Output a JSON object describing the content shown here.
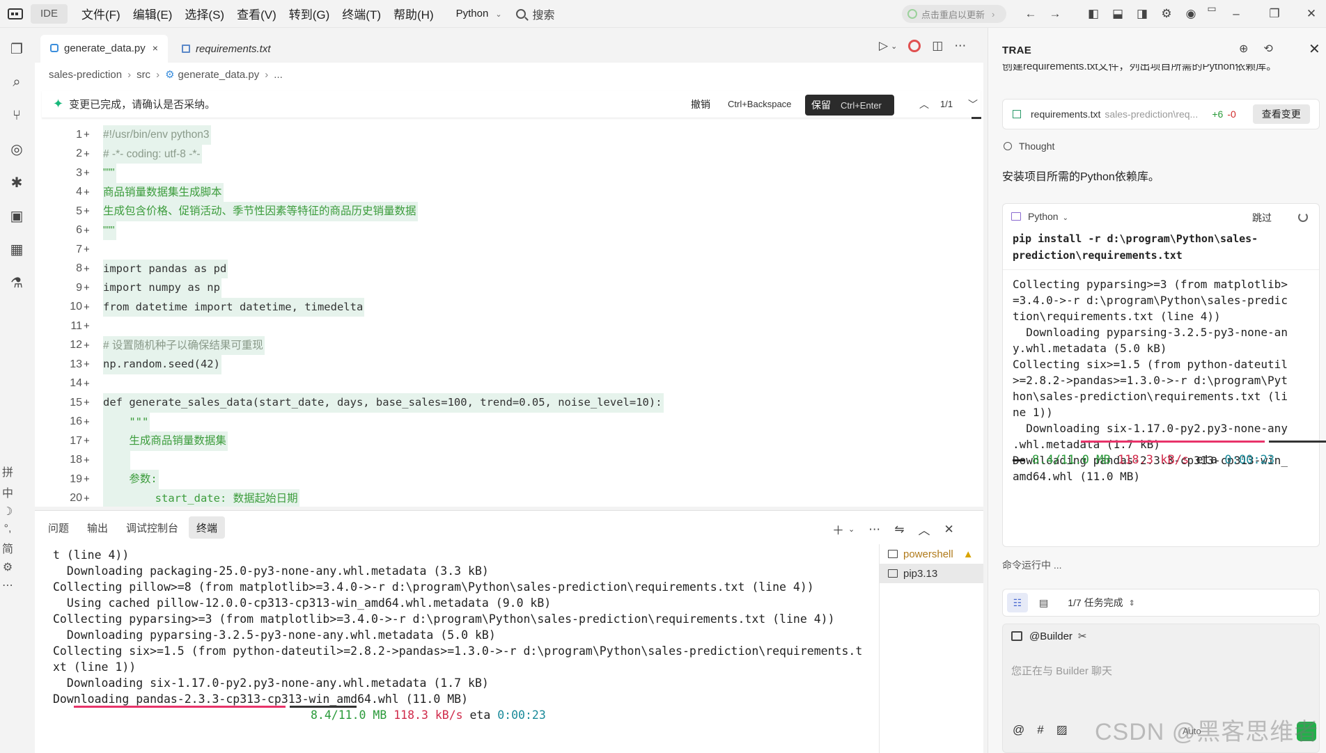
{
  "titlebar": {
    "ide_label": "IDE",
    "menu": [
      "文件(F)",
      "编辑(E)",
      "选择(S)",
      "查看(V)",
      "转到(G)",
      "终端(T)",
      "帮助(H)"
    ],
    "language": "Python",
    "search_label": "搜索",
    "update_label": "点击重启以更新"
  },
  "editor": {
    "tabs": [
      {
        "label": "generate_data.py",
        "close": "×"
      },
      {
        "label": "requirements.txt"
      }
    ],
    "breadcrumb": [
      "sales-prediction",
      "src",
      "generate_data.py",
      "..."
    ],
    "confirm": {
      "message": "变更已完成，请确认是否采纳。",
      "undo_label": "撤销",
      "undo_shortcut": "Ctrl+Backspace",
      "keep_label": "保留",
      "keep_shortcut": "Ctrl+Enter",
      "counter": "1/1"
    },
    "lines": [
      {
        "n": "1",
        "text": "#!/usr/bin/env python3"
      },
      {
        "n": "2",
        "text": "# -*- coding: utf-8 -*-"
      },
      {
        "n": "3",
        "text": "\"\"\""
      },
      {
        "n": "4",
        "text": "商品销量数据集生成脚本"
      },
      {
        "n": "5",
        "text": "生成包含价格、促销活动、季节性因素等特征的商品历史销量数据"
      },
      {
        "n": "6",
        "text": "\"\"\""
      },
      {
        "n": "7",
        "text": ""
      },
      {
        "n": "8",
        "text": "import pandas as pd"
      },
      {
        "n": "9",
        "text": "import numpy as np"
      },
      {
        "n": "10",
        "text": "from datetime import datetime, timedelta"
      },
      {
        "n": "11",
        "text": ""
      },
      {
        "n": "12",
        "text": "# 设置随机种子以确保结果可重现"
      },
      {
        "n": "13",
        "text": "np.random.seed(42)"
      },
      {
        "n": "14",
        "text": ""
      },
      {
        "n": "15",
        "text": "def generate_sales_data(start_date, days, base_sales=100, trend=0.05, noise_level=10):"
      },
      {
        "n": "16",
        "text": "    \"\"\""
      },
      {
        "n": "17",
        "text": "    生成商品销量数据集"
      },
      {
        "n": "18",
        "text": "    "
      },
      {
        "n": "19",
        "text": "    参数:"
      },
      {
        "n": "20",
        "text": "        start_date: 数据起始日期"
      }
    ]
  },
  "terminal": {
    "tabs": [
      "问题",
      "输出",
      "调试控制台",
      "终端"
    ],
    "active_tab": "终端",
    "sessions": [
      "powershell",
      "pip3.13"
    ],
    "lines": [
      "t (line 4))",
      "  Downloading packaging-25.0-py3-none-any.whl.metadata (3.3 kB)",
      "Collecting pillow>=8 (from matplotlib>=3.4.0->-r d:\\program\\Python\\sales-prediction\\requirements.txt (line 4))",
      "  Using cached pillow-12.0.0-cp313-cp313-win_amd64.whl.metadata (9.0 kB)",
      "Collecting pyparsing>=3 (from matplotlib>=3.4.0->-r d:\\program\\Python\\sales-prediction\\requirements.txt (line 4))",
      "  Downloading pyparsing-3.2.5-py3-none-any.whl.metadata (5.0 kB)",
      "Collecting six>=1.5 (from python-dateutil>=2.8.2->pandas>=1.3.0->-r d:\\program\\Python\\sales-prediction\\requirements.t",
      "xt (line 1))",
      "  Downloading six-1.17.0-py2.py3-none-any.whl.metadata (1.7 kB)",
      "Downloading pandas-2.3.3-cp313-cp313-win_amd64.whl (11.0 MB)"
    ],
    "progress": {
      "size": "8.4/11.0 MB",
      "speed": "118.3 kB/s",
      "eta_label": "eta",
      "eta": "0:00:23",
      "fraction": 0.76
    }
  },
  "chat": {
    "title": "TRAE",
    "cut_text": "创建requirements.txt文件，列出项目所需的Python依赖库。",
    "file_card": {
      "name": "requirements.txt",
      "path": "sales-prediction\\req...",
      "added": "+6",
      "removed": "-0",
      "action": "查看变更"
    },
    "thought_label": "Thought",
    "install_text": "安装项目所需的Python依赖库。",
    "command_card": {
      "shell": "Python",
      "skip_label": "跳过",
      "command": "pip install -r d:\\program\\Python\\sales-\nprediction\\requirements.txt",
      "output": "Collecting pyparsing>=3 (from matplotlib>\n=3.4.0->-r d:\\program\\Python\\sales-predic\ntion\\requirements.txt (line 4))\n  Downloading pyparsing-3.2.5-py3-none-an\ny.whl.metadata (5.0 kB)\nCollecting six>=1.5 (from python-dateutil\n>=2.8.2->pandas>=1.3.0->-r d:\\program\\Pyt\nhon\\sales-prediction\\requirements.txt (li\nne 1))\n  Downloading six-1.17.0-py2.py3-none-any\n.whl.metadata (1.7 kB)\nDownloading pandas-2.3.3-cp313-cp313-win_\namd64.whl (11.0 MB)",
      "progress": {
        "size": "8.4/11.0 MB",
        "speed": "118.3 kB/s",
        "eta_label": "eta",
        "eta": "0:00:23",
        "fraction": 0.76
      }
    },
    "running_label": "命令运行中 ...",
    "task_progress": "1/7 任务完成",
    "input": {
      "agent": "@Builder",
      "placeholder": "您正在与 Builder 聊天",
      "mode": "Auto"
    }
  },
  "watermark": "CSDN @黑客思维者"
}
